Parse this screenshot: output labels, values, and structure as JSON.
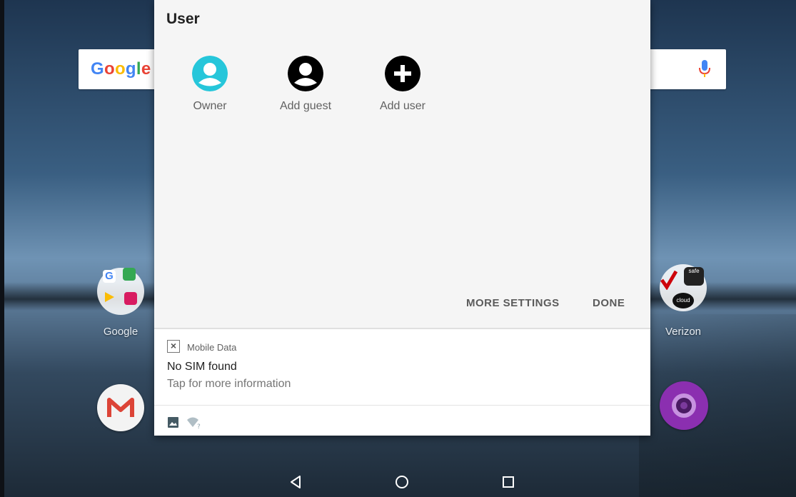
{
  "launcher": {
    "search_logo": [
      "G",
      "o",
      "o",
      "g",
      "l",
      "e"
    ],
    "folders": [
      {
        "label": "Google"
      },
      {
        "label": "Verizon"
      }
    ],
    "verizon_icons": {
      "safe": "safe",
      "cloud": "cloud"
    }
  },
  "user_panel": {
    "title": "User",
    "users": [
      {
        "label": "Owner",
        "icon": "person-icon",
        "color": "#26C6DA"
      },
      {
        "label": "Add guest",
        "icon": "guest-person-icon",
        "color": "#000000"
      },
      {
        "label": "Add user",
        "icon": "plus-circle-icon",
        "color": "#000000"
      }
    ],
    "more_settings": "MORE SETTINGS",
    "done": "DONE"
  },
  "notification": {
    "app": "Mobile Data",
    "title": "No SIM found",
    "text": "Tap for more information",
    "icon": "sim-x-icon"
  },
  "status_icons": [
    "image-icon",
    "wifi-unknown-icon"
  ],
  "nav": [
    "back-icon",
    "home-icon",
    "recents-icon"
  ],
  "colors": {
    "accent": "#26C6DA",
    "panel_bg": "#f5f5f5"
  }
}
